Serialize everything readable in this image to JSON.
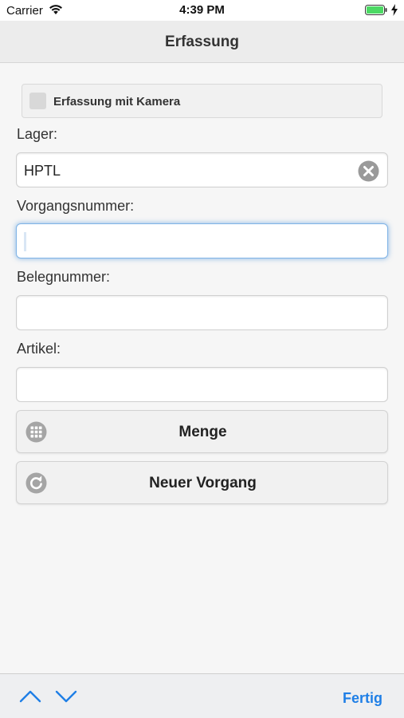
{
  "status_bar": {
    "carrier": "Carrier",
    "time": "4:39 PM",
    "battery_color": "#4cd964"
  },
  "nav": {
    "title": "Erfassung"
  },
  "camera": {
    "label": "Erfassung mit Kamera",
    "checked": false
  },
  "form": {
    "lager": {
      "label": "Lager:",
      "value": "HPTL"
    },
    "vorgangsnummer": {
      "label": "Vorgangsnummer:",
      "value": ""
    },
    "belegnummer": {
      "label": "Belegnummer:",
      "value": ""
    },
    "artikel": {
      "label": "Artikel:",
      "value": ""
    }
  },
  "buttons": {
    "menge": {
      "label": "Menge",
      "icon": "grid-icon"
    },
    "neuer_vorgang": {
      "label": "Neuer Vorgang",
      "icon": "refresh-icon"
    }
  },
  "toolbar": {
    "done_label": "Fertig",
    "accent_color": "#1f7fe6"
  }
}
